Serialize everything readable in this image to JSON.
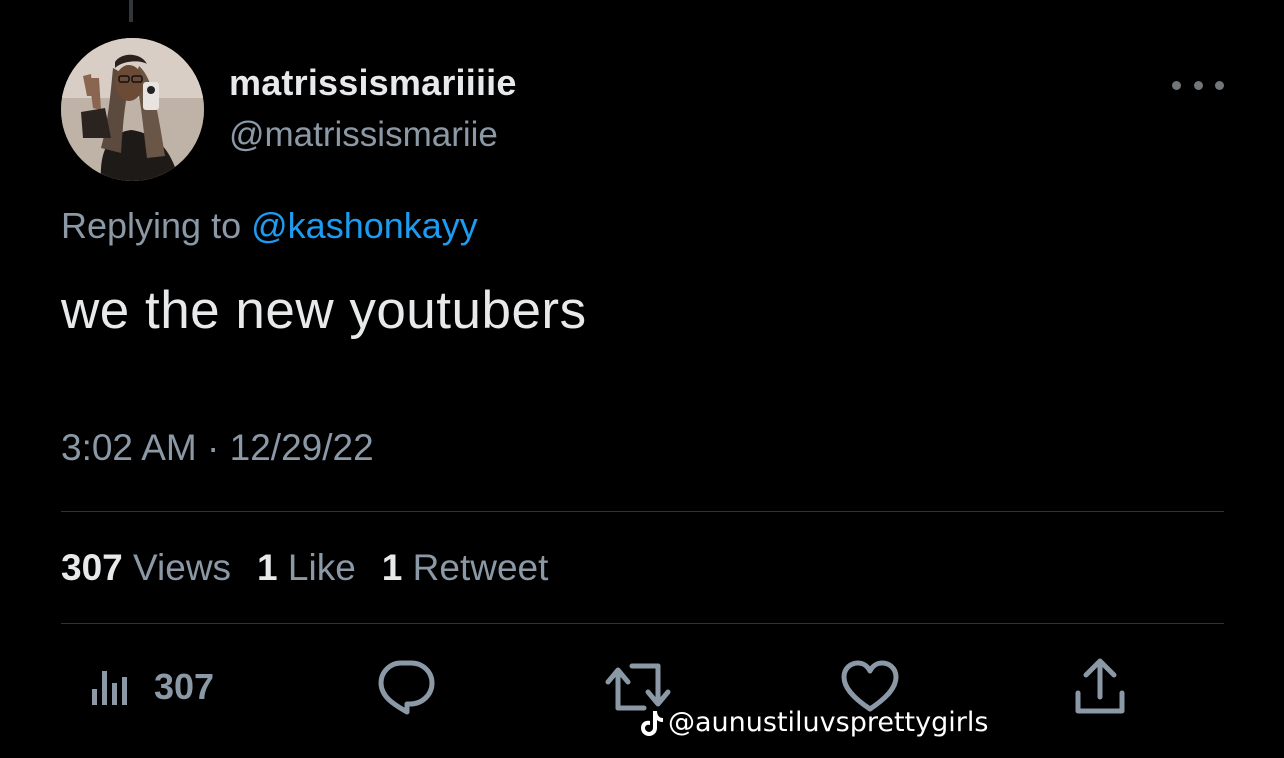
{
  "user": {
    "display_name": "matrissismariiiie",
    "handle": "@matrissismariie"
  },
  "reply": {
    "prefix": "Replying to",
    "mention": "@kashonkayy"
  },
  "tweet": {
    "text": "we the new youtubers",
    "time": "3:02 AM",
    "separator": "·",
    "date": "12/29/22"
  },
  "stats": {
    "views_count": "307",
    "views_label": "Views",
    "likes_count": "1",
    "likes_label": "Like",
    "retweets_count": "1",
    "retweets_label": "Retweet"
  },
  "actions": {
    "views_count": "307",
    "icons": [
      "analytics-icon",
      "reply-icon",
      "retweet-icon",
      "like-icon",
      "share-icon"
    ]
  },
  "watermark": {
    "text": "@aunustiluvsprettygirls",
    "icon": "tiktok-icon"
  },
  "colors": {
    "background": "#000000",
    "primary_text": "#e7e9ea",
    "secondary_text": "#8b98a5",
    "accent": "#1d9bf0",
    "divider": "#2f3336"
  }
}
